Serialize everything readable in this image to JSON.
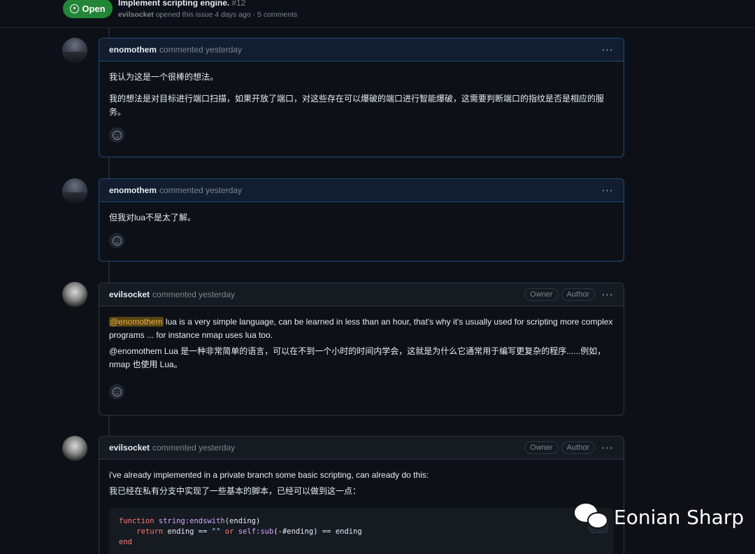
{
  "issue": {
    "state": "Open",
    "title": "Implement scripting engine.",
    "number": "#12",
    "author": "evilsocket",
    "meta": "opened this issue 4 days ago · 5 comments"
  },
  "comments": [
    {
      "user": "enomothem",
      "when": "commented yesterday",
      "body": [
        "我认为这是一个很棒的想法。",
        "我的想法是对目标进行端口扫描，如果开放了端口，对这些存在可以爆破的端口进行智能爆破，这需要判断端口的指纹是否是相应的服务。"
      ]
    },
    {
      "user": "enomothem",
      "when": "commented yesterday",
      "body": [
        "但我对lua不是太了解。"
      ]
    },
    {
      "user": "evilsocket",
      "when": "commented yesterday",
      "labels": [
        "Owner",
        "Author"
      ],
      "mention": "@enomothem",
      "body_en": " lua is a very simple language, can be learned in less than an hour, that's why it's usually used for scripting more complex programs ... for instance nmap uses lua too.",
      "body_zh": "@enomothem Lua 是一种非常简单的语言，可以在不到一个小时的时间内学会，这就是为什么它通常用于编写更复杂的程序......例如，nmap 也使用 Lua。"
    },
    {
      "user": "evilsocket",
      "when": "commented yesterday",
      "labels": [
        "Owner",
        "Author"
      ],
      "body_en": "i've already implemented in a private branch some basic scripting, can already do this:",
      "body_zh": "我已经在私有分支中实现了一些基本的脚本，已经可以做到这一点：",
      "code": {
        "l1_kw": "function",
        "l1_fn": "string:endswith",
        "l1_rest": "(ending)",
        "l2_kw": "return",
        "l2_a": " ending == ",
        "l2_str": "\"\"",
        "l2_or": " or ",
        "l2_self": "self",
        "l2_fn": ":sub",
        "l2_rest": "(-#ending) == ending",
        "l3_kw": "end"
      }
    }
  ],
  "watermark": "Eonian Sharp"
}
